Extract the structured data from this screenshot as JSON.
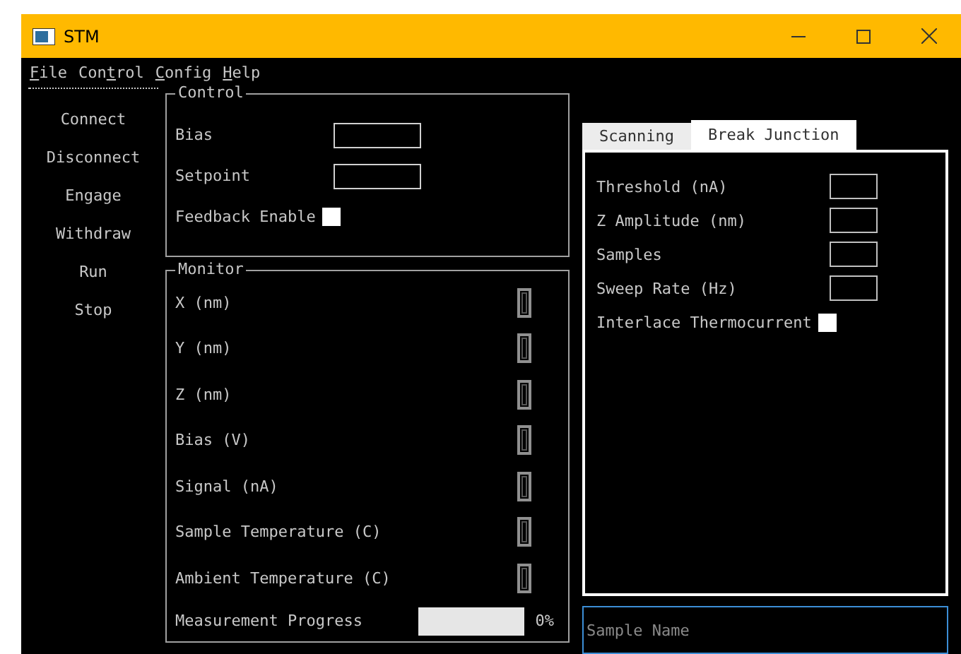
{
  "window": {
    "title": "STM"
  },
  "menu": [
    {
      "key": "F",
      "after": "ile"
    },
    {
      "before": "Con",
      "key": "t",
      "after": "rol"
    },
    {
      "key": "C",
      "after": "onfig"
    },
    {
      "key": "H",
      "after": "elp"
    }
  ],
  "sidebar": {
    "items": [
      "Connect",
      "Disconnect",
      "Engage",
      "Withdraw",
      "Run",
      "Stop"
    ]
  },
  "control": {
    "title": "Control",
    "fields": [
      {
        "kind": "input",
        "label": "Bias"
      },
      {
        "kind": "input",
        "label": "Setpoint"
      },
      {
        "kind": "checkbox",
        "label": "Feedback Enable",
        "checked": false
      }
    ]
  },
  "monitor": {
    "title": "Monitor",
    "readouts": [
      "X (nm)",
      "Y (nm)",
      "Z (nm)",
      "Bias (V)",
      "Signal (nA)",
      "Sample Temperature (C)",
      "Ambient Temperature (C)"
    ],
    "progress": {
      "label": "Measurement Progress",
      "reading": "0%"
    }
  },
  "tabs": [
    {
      "label": "Scanning",
      "selected": false
    },
    {
      "label": "Break Junction",
      "selected": true
    }
  ],
  "break_junction": {
    "fields": [
      {
        "kind": "input",
        "label": "Threshold (nA)"
      },
      {
        "kind": "input",
        "label": "Z Amplitude (nm)"
      },
      {
        "kind": "input",
        "label": "Samples"
      },
      {
        "kind": "input",
        "label": "Sweep Rate (Hz)"
      },
      {
        "kind": "checkbox",
        "label": "Interlace Thermocurrent",
        "checked": false
      }
    ]
  },
  "sample_name": {
    "placeholder": "Sample Name"
  }
}
